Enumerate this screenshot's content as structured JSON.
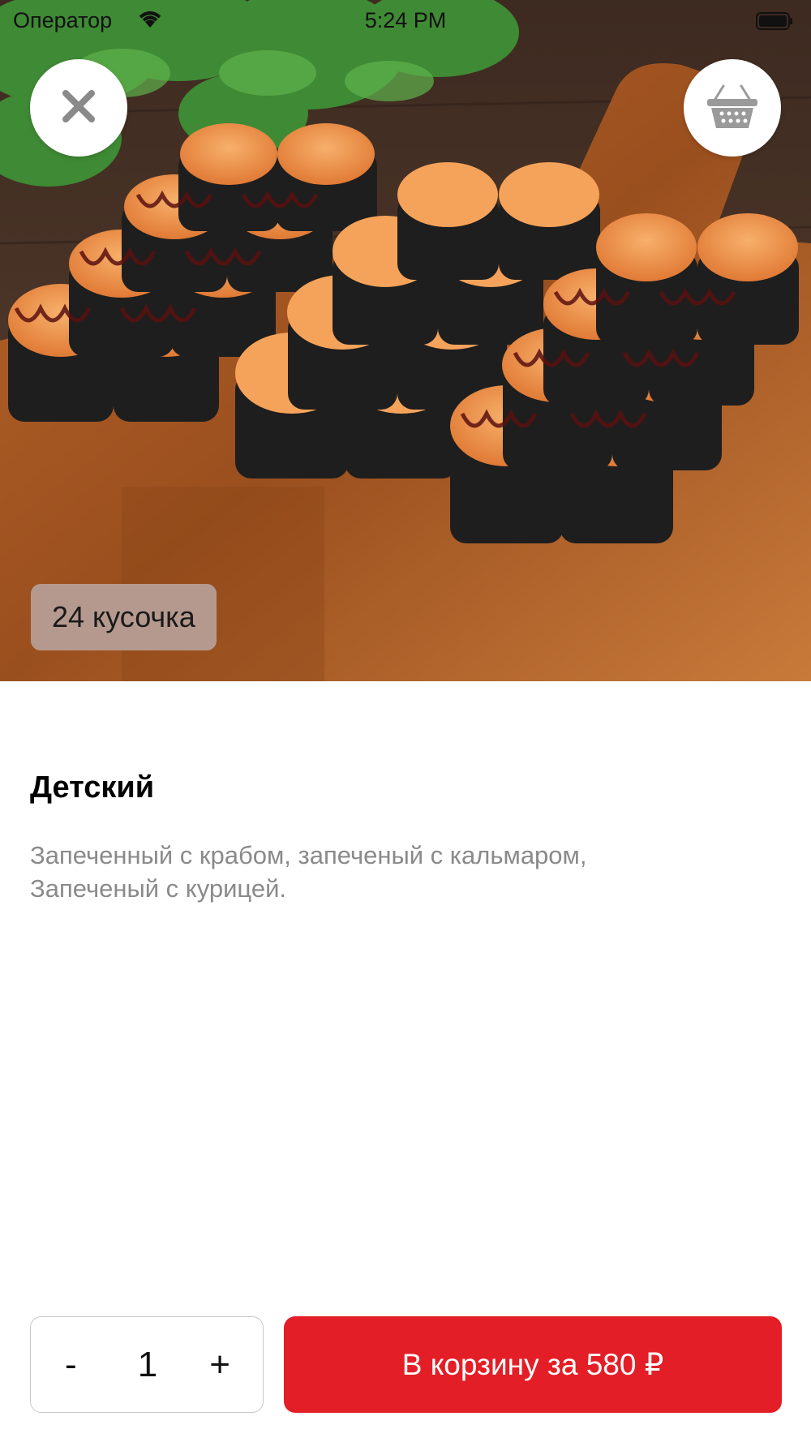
{
  "status_bar": {
    "carrier": "Оператор",
    "time": "5:24 PM"
  },
  "product": {
    "pieces_badge": "24 кусочка",
    "title": "Детский",
    "description": "Запеченный с крабом, запеченый с кальмаром,\nЗапеченый с курицей."
  },
  "icons": {
    "close": "close-icon",
    "basket": "basket-icon",
    "wifi": "wifi-icon",
    "battery": "battery-icon"
  },
  "bottom_bar": {
    "minus_label": "-",
    "quantity": "1",
    "plus_label": "+",
    "add_to_cart_label": "В корзину за 580 ₽"
  },
  "colors": {
    "accent": "#e31e26",
    "badge_bg": "#b8a098",
    "description_text": "#8a8a8a"
  }
}
